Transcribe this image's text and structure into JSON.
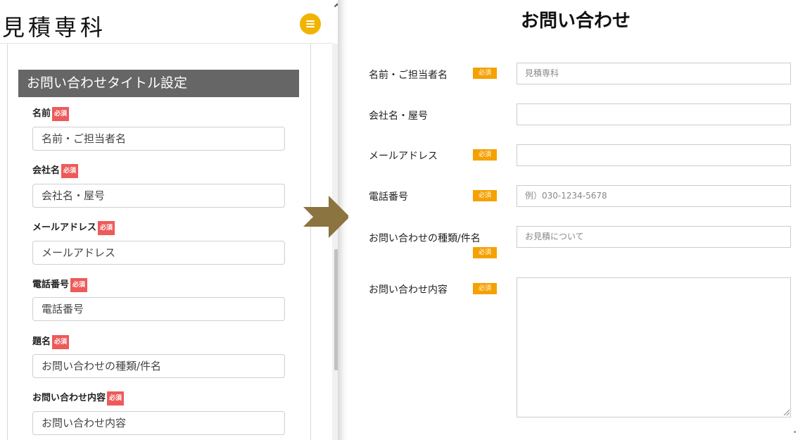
{
  "left": {
    "brand": "見積専科",
    "section_title": "お問い合わせタイトル設定",
    "required_badge": "必須",
    "fields": [
      {
        "label": "名前",
        "value": "名前・ご担当者名"
      },
      {
        "label": "会社名",
        "value": "会社名・屋号"
      },
      {
        "label": "メールアドレス",
        "value": "メールアドレス"
      },
      {
        "label": "電話番号",
        "value": "電話番号"
      },
      {
        "label": "題名",
        "value": "お問い合わせの種類/件名"
      },
      {
        "label": "お問い合わせ内容",
        "value": "お問い合わせ内容"
      }
    ]
  },
  "right": {
    "title": "お問い合わせ",
    "required_badge": "必須",
    "fields": [
      {
        "label": "名前・ご担当者名",
        "placeholder": "見積専科",
        "required": true
      },
      {
        "label": "会社名・屋号",
        "placeholder": "",
        "required": false
      },
      {
        "label": "メールアドレス",
        "placeholder": "",
        "required": true
      },
      {
        "label": "電話番号",
        "placeholder": "例）030-1234-5678",
        "required": true
      },
      {
        "label": "お問い合わせの種類/件名",
        "placeholder": "お見積について",
        "required": true
      },
      {
        "label": "お問い合わせ内容",
        "placeholder": "",
        "required": true
      }
    ]
  },
  "colors": {
    "left_badge": "#ee5a5a",
    "right_badge": "#f5a100",
    "menu_button": "#f1b400",
    "section_bar": "#666666",
    "arrow": "#8c7440"
  },
  "icons": {
    "menu": "hamburger-menu-icon",
    "arrow": "right-arrow-icon",
    "resize": "resize-handle-icon"
  }
}
